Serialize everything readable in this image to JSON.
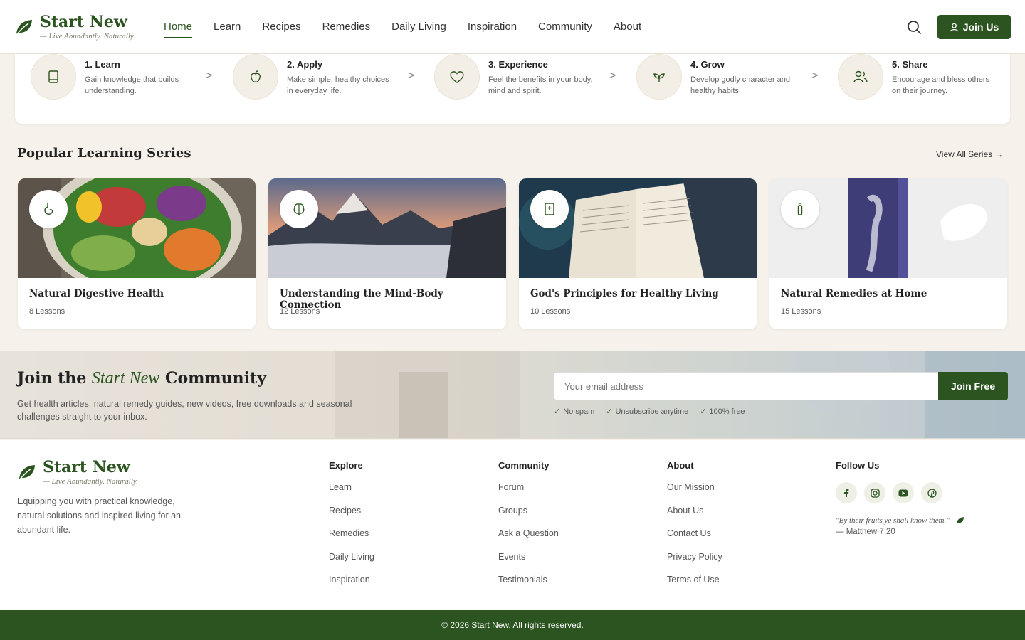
{
  "brand": {
    "name": "Start New",
    "tagline": "— Live Abundantly. Naturally."
  },
  "nav": {
    "items": [
      "Home",
      "Learn",
      "Recipes",
      "Remedies",
      "Daily Living",
      "Inspiration",
      "Community",
      "About"
    ],
    "active": "Home",
    "join_label": "Join Us"
  },
  "steps": [
    {
      "title": "1. Learn",
      "desc": "Gain knowledge that builds understanding.",
      "icon": "book-icon"
    },
    {
      "title": "2. Apply",
      "desc": "Make simple, healthy choices in everyday life.",
      "icon": "apple-icon"
    },
    {
      "title": "3. Experience",
      "desc": "Feel the benefits in your body, mind and spirit.",
      "icon": "heart-icon"
    },
    {
      "title": "4. Grow",
      "desc": "Develop godly character and healthy habits.",
      "icon": "sprout-icon"
    },
    {
      "title": "5. Share",
      "desc": "Encourage and bless others on their journey.",
      "icon": "users-icon"
    }
  ],
  "step_separator": ">",
  "series": {
    "title": "Popular Learning Series",
    "view_all": "View All Series →",
    "cards": [
      {
        "title": "Natural Digestive Health",
        "lessons": "8 Lessons",
        "icon": "stomach-icon"
      },
      {
        "title": "Understanding the Mind-Body Connection",
        "lessons": "12 Lessons",
        "icon": "brain-icon"
      },
      {
        "title": "God's Principles for Healthy Living",
        "lessons": "10 Lessons",
        "icon": "bible-icon"
      },
      {
        "title": "Natural Remedies at Home",
        "lessons": "15 Lessons",
        "icon": "bottle-icon"
      }
    ]
  },
  "newsletter": {
    "title_prefix": "Join the",
    "title_script": "Start New",
    "title_suffix": "Community",
    "desc": "Get health articles, natural remedy guides, new videos, free downloads and seasonal challenges straight to your inbox.",
    "placeholder": "Your email address",
    "button": "Join Free",
    "checks": [
      "No spam",
      "Unsubscribe anytime",
      "100% free"
    ]
  },
  "footer": {
    "desc": "Equipping you with practical knowledge, natural solutions and inspired living for an abundant life.",
    "columns": [
      {
        "title": "Explore",
        "links": [
          "Learn",
          "Recipes",
          "Remedies",
          "Daily Living",
          "Inspiration"
        ]
      },
      {
        "title": "Community",
        "links": [
          "Forum",
          "Groups",
          "Ask a Question",
          "Events",
          "Testimonials"
        ]
      },
      {
        "title": "About",
        "links": [
          "Our Mission",
          "About Us",
          "Contact Us",
          "Privacy Policy",
          "Terms of Use"
        ]
      }
    ],
    "follow_title": "Follow Us",
    "socials": [
      "facebook-icon",
      "instagram-icon",
      "youtube-icon",
      "pinterest-icon"
    ],
    "quote": "\"By their fruits ye shall know them.\"",
    "quote_ref": "— Matthew 7:20",
    "copyright": "© 2026 Start New. All rights reserved."
  },
  "colors": {
    "primary": "#2b5420",
    "background": "#f6f1ea",
    "card_icon_bg": "#f4efe6"
  }
}
